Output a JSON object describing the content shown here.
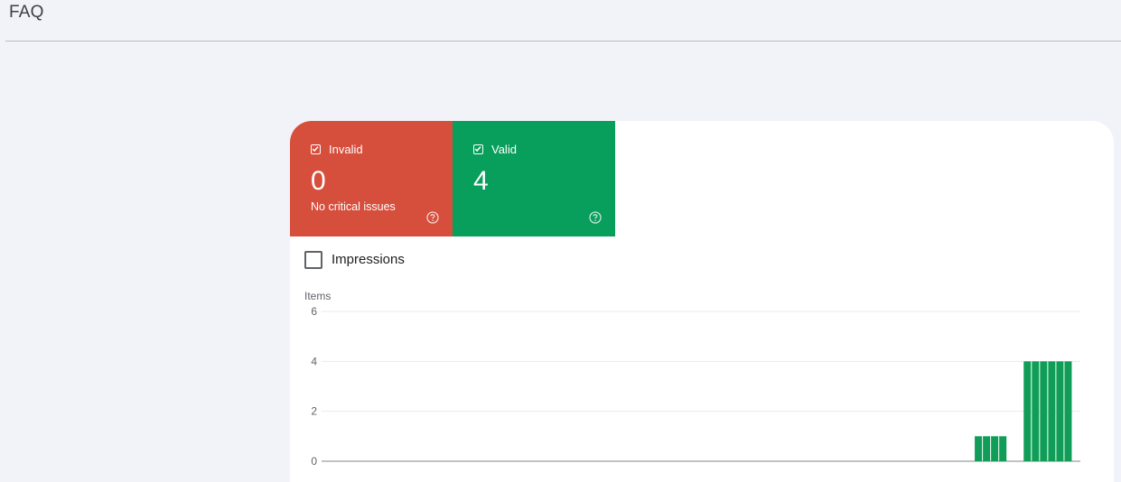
{
  "page": {
    "title": "FAQ"
  },
  "tiles": {
    "invalid": {
      "label": "Invalid",
      "value": "0",
      "subtitle": "No critical issues",
      "color": "#d64e3c",
      "checked": true,
      "help_icon": "help-circle-icon"
    },
    "valid": {
      "label": "Valid",
      "value": "4",
      "color": "#089e5c",
      "checked": true,
      "help_icon": "help-circle-icon"
    }
  },
  "impressions": {
    "label": "Impressions",
    "checked": false
  },
  "chart_data": {
    "type": "bar",
    "ylabel": "Items",
    "ylim": [
      0,
      6
    ],
    "yticks": [
      "0",
      "2",
      "4",
      "6"
    ],
    "grid": true,
    "bar_color": "#0f9d58",
    "values": [
      0,
      0,
      0,
      0,
      0,
      0,
      0,
      0,
      0,
      0,
      0,
      0,
      0,
      0,
      0,
      0,
      0,
      0,
      0,
      0,
      0,
      0,
      0,
      0,
      0,
      0,
      0,
      0,
      0,
      0,
      0,
      0,
      0,
      0,
      0,
      0,
      0,
      0,
      0,
      0,
      0,
      0,
      0,
      0,
      0,
      0,
      0,
      0,
      0,
      0,
      0,
      0,
      0,
      0,
      0,
      0,
      0,
      0,
      0,
      0,
      0,
      0,
      0,
      0,
      0,
      0,
      0,
      0,
      0,
      0,
      0,
      0,
      0,
      0,
      0,
      0,
      0,
      0,
      0,
      0,
      1,
      1,
      1,
      1,
      0,
      0,
      4,
      4,
      4,
      4,
      4,
      4,
      0
    ]
  }
}
